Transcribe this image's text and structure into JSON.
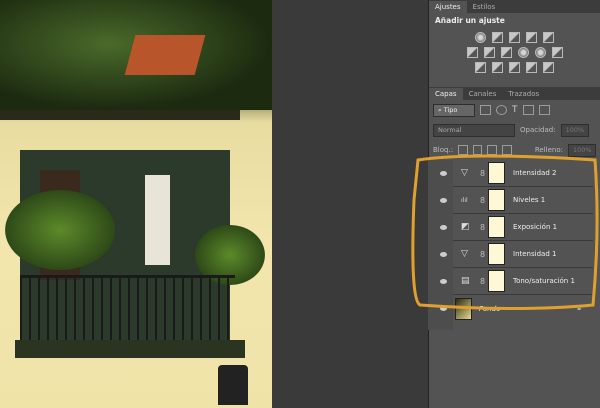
{
  "adjustments_panel": {
    "tabs": [
      "Ajustes",
      "Estilos"
    ],
    "title": "Añadir un ajuste"
  },
  "layers_panel": {
    "tabs": [
      "Capas",
      "Canales",
      "Trazados"
    ],
    "filter_kind": "Tipo",
    "blend_mode": "Normal",
    "opacity_label": "Opacidad:",
    "opacity_value": "100%",
    "lock_label": "Bloq.:",
    "fill_label": "Relleno:",
    "fill_value": "100%",
    "layers": [
      {
        "name": "Intensidad 2",
        "icon": "▽"
      },
      {
        "name": "Niveles 1",
        "icon": "ılıl"
      },
      {
        "name": "Exposición 1",
        "icon": "◩"
      },
      {
        "name": "Intensidad 1",
        "icon": "▽"
      },
      {
        "name": "Tono/saturación 1",
        "icon": "▤"
      }
    ],
    "background_layer": {
      "name": "Fondo"
    }
  },
  "colors": {
    "highlight": "#e0a030",
    "panel": "#535353"
  }
}
